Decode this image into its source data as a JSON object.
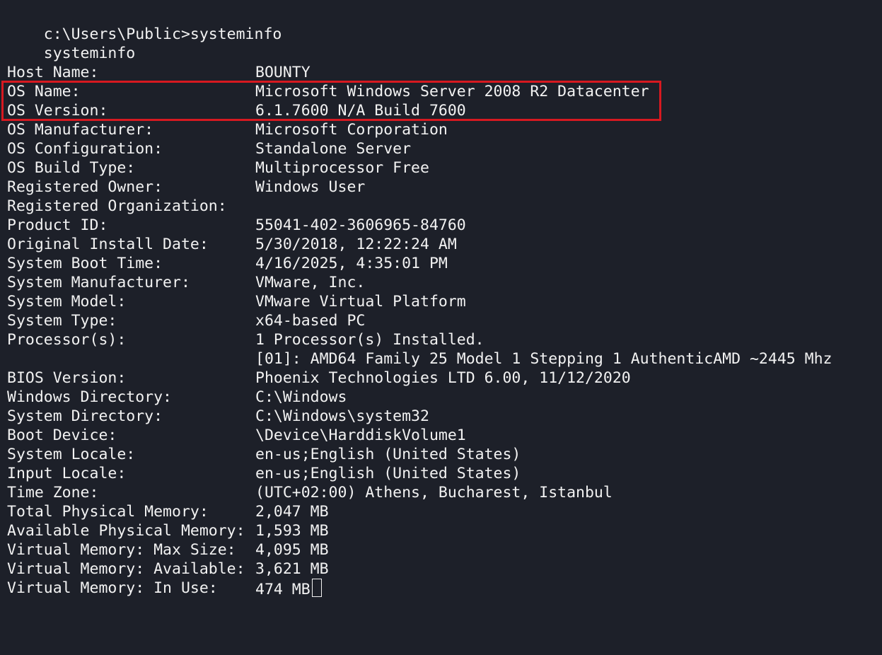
{
  "command": {
    "prompt_line": "c:\\Users\\Public>systeminfo",
    "echo_line": "systeminfo"
  },
  "highlight_color": "#d71920",
  "rows": [
    {
      "label": "Host Name:",
      "value": "BOUNTY"
    },
    {
      "label": "OS Name:",
      "value": "Microsoft Windows Server 2008 R2 Datacenter"
    },
    {
      "label": "OS Version:",
      "value": "6.1.7600 N/A Build 7600"
    },
    {
      "label": "OS Manufacturer:",
      "value": "Microsoft Corporation"
    },
    {
      "label": "OS Configuration:",
      "value": "Standalone Server"
    },
    {
      "label": "OS Build Type:",
      "value": "Multiprocessor Free"
    },
    {
      "label": "Registered Owner:",
      "value": "Windows User"
    },
    {
      "label": "Registered Organization:",
      "value": ""
    },
    {
      "label": "Product ID:",
      "value": "55041-402-3606965-84760"
    },
    {
      "label": "Original Install Date:",
      "value": "5/30/2018, 12:22:24 AM"
    },
    {
      "label": "System Boot Time:",
      "value": "4/16/2025, 4:35:01 PM"
    },
    {
      "label": "System Manufacturer:",
      "value": "VMware, Inc."
    },
    {
      "label": "System Model:",
      "value": "VMware Virtual Platform"
    },
    {
      "label": "System Type:",
      "value": "x64-based PC"
    },
    {
      "label": "Processor(s):",
      "value": "1 Processor(s) Installed."
    },
    {
      "label": "",
      "value": "[01]: AMD64 Family 25 Model 1 Stepping 1 AuthenticAMD ~2445 Mhz"
    },
    {
      "label": "BIOS Version:",
      "value": "Phoenix Technologies LTD 6.00, 11/12/2020"
    },
    {
      "label": "Windows Directory:",
      "value": "C:\\Windows"
    },
    {
      "label": "System Directory:",
      "value": "C:\\Windows\\system32"
    },
    {
      "label": "Boot Device:",
      "value": "\\Device\\HarddiskVolume1"
    },
    {
      "label": "System Locale:",
      "value": "en-us;English (United States)"
    },
    {
      "label": "Input Locale:",
      "value": "en-us;English (United States)"
    },
    {
      "label": "Time Zone:",
      "value": "(UTC+02:00) Athens, Bucharest, Istanbul"
    },
    {
      "label": "Total Physical Memory:",
      "value": "2,047 MB"
    },
    {
      "label": "Available Physical Memory:",
      "value": "1,593 MB"
    },
    {
      "label": "Virtual Memory: Max Size:",
      "value": "4,095 MB"
    },
    {
      "label": "Virtual Memory: Available:",
      "value": "3,621 MB"
    },
    {
      "label": "Virtual Memory: In Use:",
      "value": "474 MB"
    }
  ]
}
